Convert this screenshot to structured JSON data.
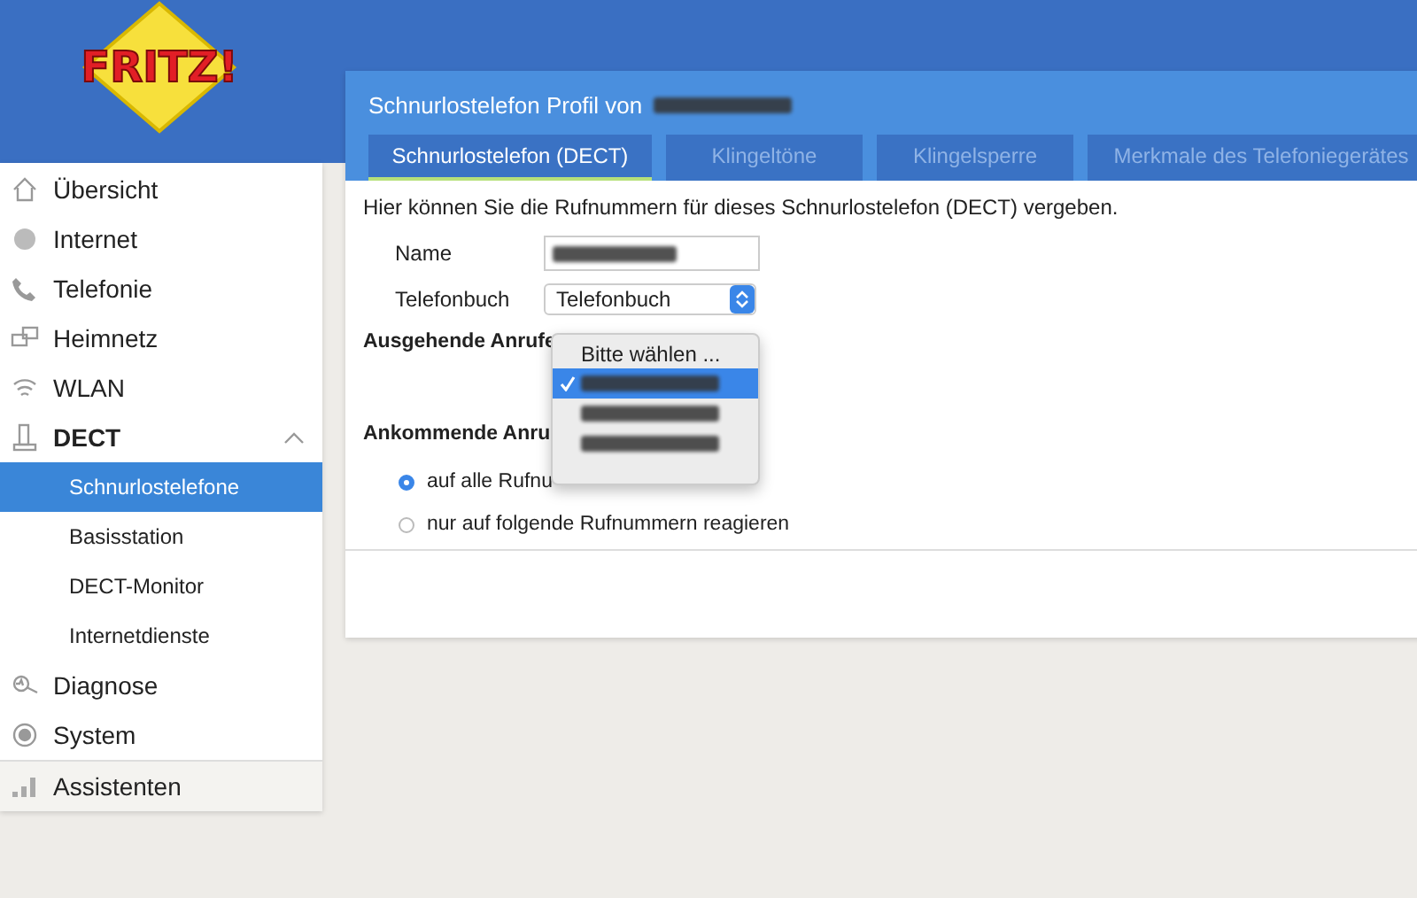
{
  "logo": {
    "text": "FRITZ!"
  },
  "sidebar": {
    "items": [
      {
        "label": "Übersicht",
        "selected": false
      },
      {
        "label": "Internet",
        "selected": false
      },
      {
        "label": "Telefonie",
        "selected": false
      },
      {
        "label": "Heimnetz",
        "selected": false
      },
      {
        "label": "WLAN",
        "selected": false
      },
      {
        "label": "DECT",
        "selected": false,
        "expanded": true,
        "children": [
          {
            "label": "Schnurlostelefone",
            "selected": true
          },
          {
            "label": "Basisstation",
            "selected": false
          },
          {
            "label": "DECT-Monitor",
            "selected": false
          },
          {
            "label": "Internetdienste",
            "selected": false
          }
        ]
      },
      {
        "label": "Diagnose",
        "selected": false
      },
      {
        "label": "System",
        "selected": false
      }
    ],
    "footer": {
      "label": "Assistenten"
    }
  },
  "panel": {
    "title": "Schnurlostelefon Profil von",
    "tabs": [
      {
        "label": "Schnurlostelefon (DECT)",
        "selected": true
      },
      {
        "label": "Klingeltöne",
        "selected": false
      },
      {
        "label": "Klingelsperre",
        "selected": false
      },
      {
        "label": "Merkmale des Telefoniegerätes",
        "selected": false
      }
    ],
    "intro": "Hier können Sie die Rufnummern für dieses Schnurlostelefon (DECT) vergeben.",
    "fields": [
      {
        "label": "Name",
        "kind": "text"
      },
      {
        "label": "Telefonbuch",
        "kind": "select",
        "value": "Telefonbuch"
      }
    ],
    "outgoing": {
      "heading": "Ausgehende Anrufe"
    },
    "incoming": {
      "heading": "Ankommende Anru",
      "options": [
        {
          "label": "auf alle Rufnu",
          "selected": true
        },
        {
          "label": "nur auf folgende Rufnummern reagieren",
          "selected": false
        }
      ]
    },
    "menu": {
      "options": [
        {
          "kind": "text",
          "label": "Bitte wählen ...",
          "selected": false
        },
        {
          "kind": "redacted",
          "selected": true
        },
        {
          "kind": "redacted",
          "selected": false
        },
        {
          "kind": "redacted",
          "selected": false
        }
      ]
    }
  }
}
